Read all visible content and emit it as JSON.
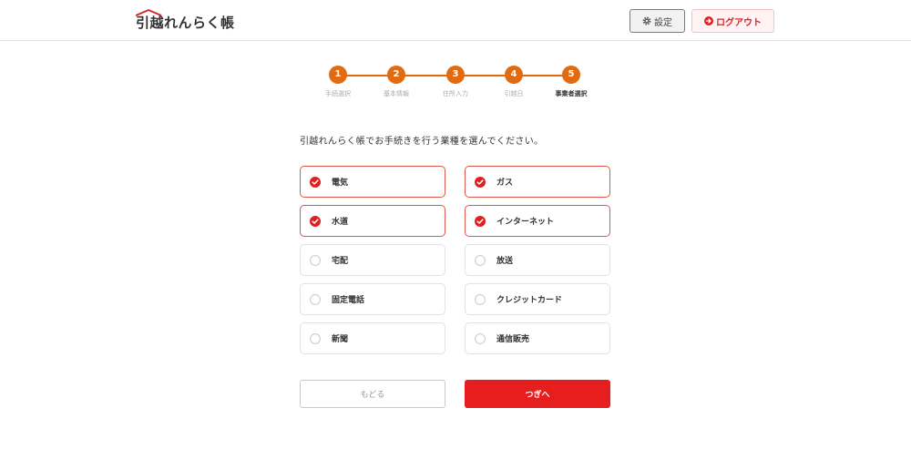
{
  "header": {
    "logo_text": "引越れんらく帳",
    "settings_label": "設定",
    "logout_label": "ログアウト"
  },
  "stepper": {
    "steps": [
      {
        "number": "1",
        "label": "手続選択"
      },
      {
        "number": "2",
        "label": "基本情報"
      },
      {
        "number": "3",
        "label": "住所入力"
      },
      {
        "number": "4",
        "label": "引越日"
      },
      {
        "number": "5",
        "label": "事業者選択"
      }
    ],
    "current_step": 5
  },
  "instruction": "引越れんらく帳でお手続きを行う業種を選んでください。",
  "options": [
    {
      "label": "電気",
      "selected": true
    },
    {
      "label": "ガス",
      "selected": true
    },
    {
      "label": "水道",
      "selected": true
    },
    {
      "label": "インターネット",
      "selected": true
    },
    {
      "label": "宅配",
      "selected": false
    },
    {
      "label": "放送",
      "selected": false
    },
    {
      "label": "固定電話",
      "selected": false
    },
    {
      "label": "クレジットカード",
      "selected": false
    },
    {
      "label": "新聞",
      "selected": false
    },
    {
      "label": "通信販売",
      "selected": false
    }
  ],
  "actions": {
    "back_label": "もどる",
    "next_label": "つぎへ"
  },
  "colors": {
    "accent_orange": "#e26b12",
    "primary_red": "#e61e1e",
    "selected_border": "#e0554d"
  },
  "icons": {
    "settings": "gear-icon",
    "logout": "arrow-right-circle-icon",
    "selected": "check-circle-icon",
    "unselected": "empty-circle-icon"
  }
}
